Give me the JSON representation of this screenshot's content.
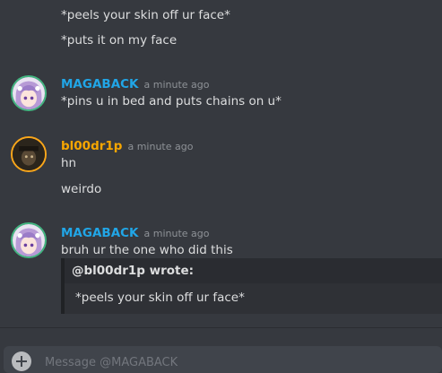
{
  "messages": [
    {
      "text": "*peels your skin off ur face*"
    },
    {
      "text": "*puts it on my face"
    },
    {
      "author": "MAGABACK",
      "time": "a minute ago",
      "lines": [
        "*pins u in bed and puts chains on u*"
      ]
    },
    {
      "author": "bl00dr1p",
      "time": "a minute ago",
      "lines": [
        "hn",
        "weirdo"
      ]
    },
    {
      "author": "MAGABACK",
      "time": "a minute ago",
      "lines": [
        "bruh ur the one who did this"
      ]
    }
  ],
  "quote": {
    "header": "@bl00dr1p wrote:",
    "body": "*peels your skin off ur face*"
  },
  "composer": {
    "placeholder": "Message @MAGABACK"
  },
  "colors": {
    "background": "#36393f",
    "username_magaback": "#21a6e7",
    "username_bl00dr1p": "#f7a600",
    "timestamp": "#8e9297"
  }
}
